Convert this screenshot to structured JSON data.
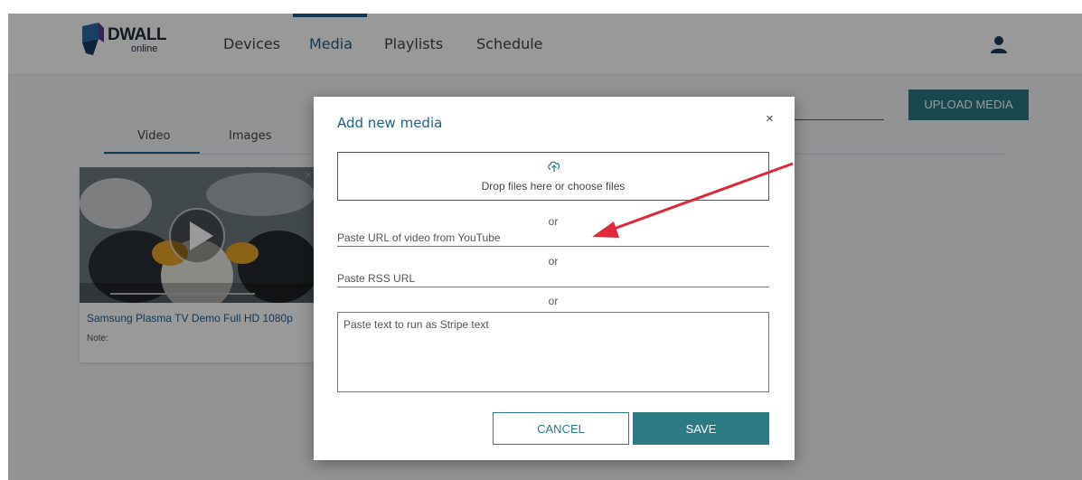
{
  "logo": {
    "text": "DWALL",
    "sub": "online"
  },
  "nav": {
    "items": [
      "Devices",
      "Media",
      "Playlists",
      "Schedule"
    ],
    "active": "Media"
  },
  "toolbar": {
    "upload_label": "UPLOAD MEDIA"
  },
  "tabs": {
    "items": [
      "Video",
      "Images"
    ],
    "active": "Video"
  },
  "card": {
    "title": "Samsung Plasma TV Demo Full HD 1080p",
    "note": "Note:",
    "close": "✕"
  },
  "dialog": {
    "title": "Add new media",
    "close": "×",
    "drop_text": "Drop files here or choose files",
    "or": "or",
    "youtube_placeholder": "Paste URL of video from YouTube",
    "rss_placeholder": "Paste RSS URL",
    "stripe_placeholder": "Paste text to run as Stripe text",
    "cancel_label": "CANCEL",
    "save_label": "SAVE"
  },
  "icons": {
    "logo": "dwall-logo-icon",
    "user": "user-icon",
    "upload": "cloud-upload-icon",
    "play": "play-icon",
    "close": "close-icon"
  },
  "colors": {
    "brand": "#1f5f8b",
    "accent": "#2b7a84",
    "annotation": "#e0283a"
  }
}
